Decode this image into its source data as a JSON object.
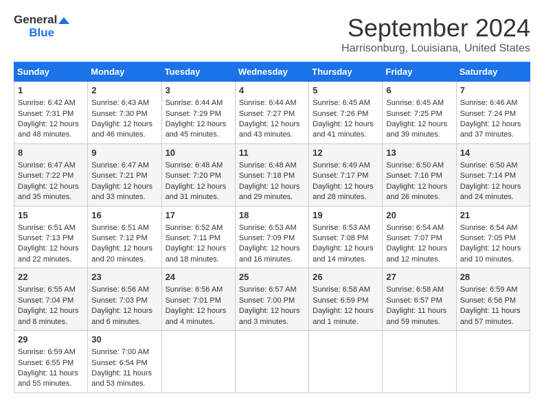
{
  "logo": {
    "line1": "General",
    "line2": "Blue"
  },
  "title": "September 2024",
  "location": "Harrisonburg, Louisiana, United States",
  "days": [
    "Sunday",
    "Monday",
    "Tuesday",
    "Wednesday",
    "Thursday",
    "Friday",
    "Saturday"
  ],
  "weeks": [
    [
      {
        "day": "1",
        "sunrise": "6:42 AM",
        "sunset": "7:31 PM",
        "daylight": "12 hours and 48 minutes."
      },
      {
        "day": "2",
        "sunrise": "6:43 AM",
        "sunset": "7:30 PM",
        "daylight": "12 hours and 46 minutes."
      },
      {
        "day": "3",
        "sunrise": "6:44 AM",
        "sunset": "7:29 PM",
        "daylight": "12 hours and 45 minutes."
      },
      {
        "day": "4",
        "sunrise": "6:44 AM",
        "sunset": "7:27 PM",
        "daylight": "12 hours and 43 minutes."
      },
      {
        "day": "5",
        "sunrise": "6:45 AM",
        "sunset": "7:26 PM",
        "daylight": "12 hours and 41 minutes."
      },
      {
        "day": "6",
        "sunrise": "6:45 AM",
        "sunset": "7:25 PM",
        "daylight": "12 hours and 39 minutes."
      },
      {
        "day": "7",
        "sunrise": "6:46 AM",
        "sunset": "7:24 PM",
        "daylight": "12 hours and 37 minutes."
      }
    ],
    [
      {
        "day": "8",
        "sunrise": "6:47 AM",
        "sunset": "7:22 PM",
        "daylight": "12 hours and 35 minutes."
      },
      {
        "day": "9",
        "sunrise": "6:47 AM",
        "sunset": "7:21 PM",
        "daylight": "12 hours and 33 minutes."
      },
      {
        "day": "10",
        "sunrise": "6:48 AM",
        "sunset": "7:20 PM",
        "daylight": "12 hours and 31 minutes."
      },
      {
        "day": "11",
        "sunrise": "6:48 AM",
        "sunset": "7:18 PM",
        "daylight": "12 hours and 29 minutes."
      },
      {
        "day": "12",
        "sunrise": "6:49 AM",
        "sunset": "7:17 PM",
        "daylight": "12 hours and 28 minutes."
      },
      {
        "day": "13",
        "sunrise": "6:50 AM",
        "sunset": "7:16 PM",
        "daylight": "12 hours and 26 minutes."
      },
      {
        "day": "14",
        "sunrise": "6:50 AM",
        "sunset": "7:14 PM",
        "daylight": "12 hours and 24 minutes."
      }
    ],
    [
      {
        "day": "15",
        "sunrise": "6:51 AM",
        "sunset": "7:13 PM",
        "daylight": "12 hours and 22 minutes."
      },
      {
        "day": "16",
        "sunrise": "6:51 AM",
        "sunset": "7:12 PM",
        "daylight": "12 hours and 20 minutes."
      },
      {
        "day": "17",
        "sunrise": "6:52 AM",
        "sunset": "7:11 PM",
        "daylight": "12 hours and 18 minutes."
      },
      {
        "day": "18",
        "sunrise": "6:53 AM",
        "sunset": "7:09 PM",
        "daylight": "12 hours and 16 minutes."
      },
      {
        "day": "19",
        "sunrise": "6:53 AM",
        "sunset": "7:08 PM",
        "daylight": "12 hours and 14 minutes."
      },
      {
        "day": "20",
        "sunrise": "6:54 AM",
        "sunset": "7:07 PM",
        "daylight": "12 hours and 12 minutes."
      },
      {
        "day": "21",
        "sunrise": "6:54 AM",
        "sunset": "7:05 PM",
        "daylight": "12 hours and 10 minutes."
      }
    ],
    [
      {
        "day": "22",
        "sunrise": "6:55 AM",
        "sunset": "7:04 PM",
        "daylight": "12 hours and 8 minutes."
      },
      {
        "day": "23",
        "sunrise": "6:56 AM",
        "sunset": "7:03 PM",
        "daylight": "12 hours and 6 minutes."
      },
      {
        "day": "24",
        "sunrise": "6:56 AM",
        "sunset": "7:01 PM",
        "daylight": "12 hours and 4 minutes."
      },
      {
        "day": "25",
        "sunrise": "6:57 AM",
        "sunset": "7:00 PM",
        "daylight": "12 hours and 3 minutes."
      },
      {
        "day": "26",
        "sunrise": "6:58 AM",
        "sunset": "6:59 PM",
        "daylight": "12 hours and 1 minute."
      },
      {
        "day": "27",
        "sunrise": "6:58 AM",
        "sunset": "6:57 PM",
        "daylight": "11 hours and 59 minutes."
      },
      {
        "day": "28",
        "sunrise": "6:59 AM",
        "sunset": "6:56 PM",
        "daylight": "11 hours and 57 minutes."
      }
    ],
    [
      {
        "day": "29",
        "sunrise": "6:59 AM",
        "sunset": "6:55 PM",
        "daylight": "11 hours and 55 minutes."
      },
      {
        "day": "30",
        "sunrise": "7:00 AM",
        "sunset": "6:54 PM",
        "daylight": "11 hours and 53 minutes."
      },
      null,
      null,
      null,
      null,
      null
    ]
  ]
}
